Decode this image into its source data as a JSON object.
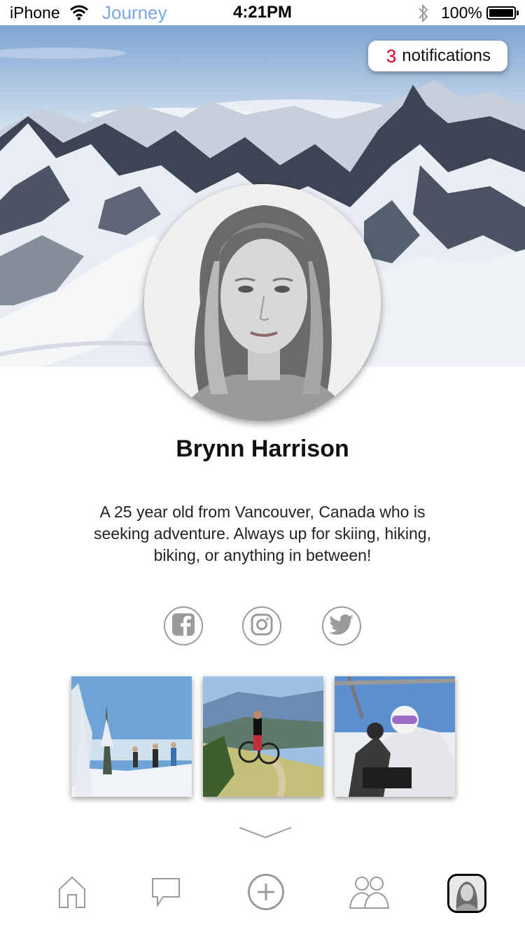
{
  "status_bar": {
    "carrier": "iPhone",
    "app_name": "Journey",
    "time": "4:21PM",
    "battery": "100%",
    "wifi_icon": "wifi-icon",
    "bluetooth_icon": "bluetooth-icon"
  },
  "header": {
    "notifications_count": "3",
    "notifications_label": "notifications"
  },
  "profile": {
    "name": "Brynn Harrison",
    "bio": "A 25 year old from Vancouver, Canada who is seeking adventure. Always up for skiing, hiking, biking, or anything in between!"
  },
  "social": [
    {
      "icon": "facebook-icon"
    },
    {
      "icon": "instagram-icon"
    },
    {
      "icon": "twitter-icon"
    }
  ],
  "tab_bar": [
    {
      "icon": "home-icon"
    },
    {
      "icon": "chat-bubble-icon"
    },
    {
      "icon": "plus-circle-icon"
    },
    {
      "icon": "people-icon"
    },
    {
      "icon": "profile-avatar"
    }
  ],
  "colors": {
    "accent_red": "#d0021b",
    "app_name_blue": "#7aa7e0",
    "icon_gray": "#9b9b9b"
  }
}
